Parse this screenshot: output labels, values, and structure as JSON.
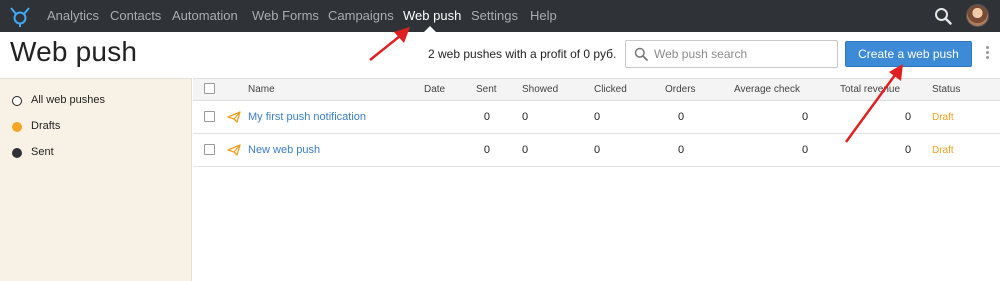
{
  "nav": {
    "items": [
      {
        "label": "Analytics"
      },
      {
        "label": "Contacts"
      },
      {
        "label": "Automation"
      },
      {
        "label": "Web Forms"
      },
      {
        "label": "Campaigns"
      },
      {
        "label": "Web push",
        "active": true
      },
      {
        "label": "Settings"
      },
      {
        "label": "Help"
      }
    ]
  },
  "header": {
    "title": "Web push",
    "summary": "2 web pushes with a profit of 0 руб.",
    "search_placeholder": "Web push search",
    "create_label": "Create a web push"
  },
  "sidebar": {
    "items": [
      {
        "label": "All web pushes",
        "dot_color": "#ffffff"
      },
      {
        "label": "Drafts",
        "dot_color": "#f5a623"
      },
      {
        "label": "Sent",
        "dot_color": "#2f3237"
      }
    ]
  },
  "table": {
    "columns": [
      "Name",
      "Date",
      "Sent",
      "Showed",
      "Clicked",
      "Orders",
      "Average check",
      "Total revenue",
      "Status"
    ],
    "rows": [
      {
        "name": "My first push notification",
        "date": "",
        "sent": "0",
        "showed": "0",
        "clicked": "0",
        "orders": "0",
        "average_check": "0",
        "total_revenue": "0",
        "status": "Draft"
      },
      {
        "name": "New web push",
        "date": "",
        "sent": "0",
        "showed": "0",
        "clicked": "0",
        "orders": "0",
        "average_check": "0",
        "total_revenue": "0",
        "status": "Draft"
      }
    ]
  },
  "colors": {
    "nav_bg": "#2f3237",
    "accent_blue": "#3d8ad6",
    "link": "#3a7fc6",
    "draft_status": "#f0a020",
    "sidebar_bg": "#f7f2e5",
    "annotation_arrow": "#e02020"
  },
  "icons": [
    "logo-icon",
    "search-icon",
    "avatar",
    "kebab-menu-icon",
    "paper-plane-icon",
    "checkbox"
  ]
}
